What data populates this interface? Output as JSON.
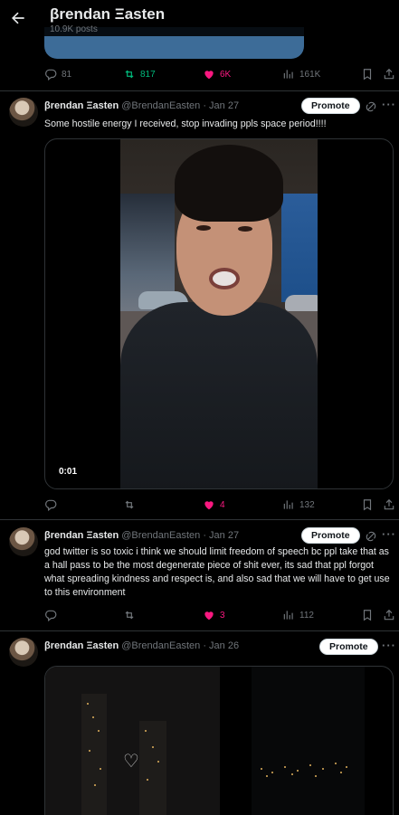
{
  "header": {
    "name": "βrendan Ξasten",
    "posts": "10.9K posts"
  },
  "prev_tweet": {
    "replies": "81",
    "reposts": "817",
    "likes": "6K",
    "views": "161K"
  },
  "tweets": [
    {
      "name": "βrendan Ξasten",
      "meta": "@BrendanEasten · Jan 27",
      "promote": "Promote",
      "text": "Some hostile energy I received, stop invading ppls space period!!!!",
      "video_time": "0:01",
      "replies": "",
      "reposts": "",
      "likes": "4",
      "views": "132"
    },
    {
      "name": "βrendan Ξasten",
      "meta": "@BrendanEasten · Jan 27",
      "promote": "Promote",
      "text": "god twitter is so toxic i think we should limit freedom of speech bc ppl take that as a hall pass to be the most degenerate piece of shit ever, its sad that ppl forgot what spreading kindness and respect is, and also sad that we will have to get use to this environment",
      "replies": "",
      "reposts": "",
      "likes": "3",
      "views": "112"
    },
    {
      "name": "βrendan Ξasten",
      "meta": "@BrendanEasten · Jan 26",
      "promote": "Promote"
    }
  ],
  "colors": {
    "repost_active": "#00ba7c",
    "like_active": "#f91880",
    "muted": "#71767b",
    "divider": "#2f3336"
  },
  "icons": [
    "back-arrow-icon",
    "reply-icon",
    "repost-icon",
    "like-icon",
    "views-icon",
    "bookmark-icon",
    "share-icon",
    "grok-icon",
    "more-icon"
  ]
}
